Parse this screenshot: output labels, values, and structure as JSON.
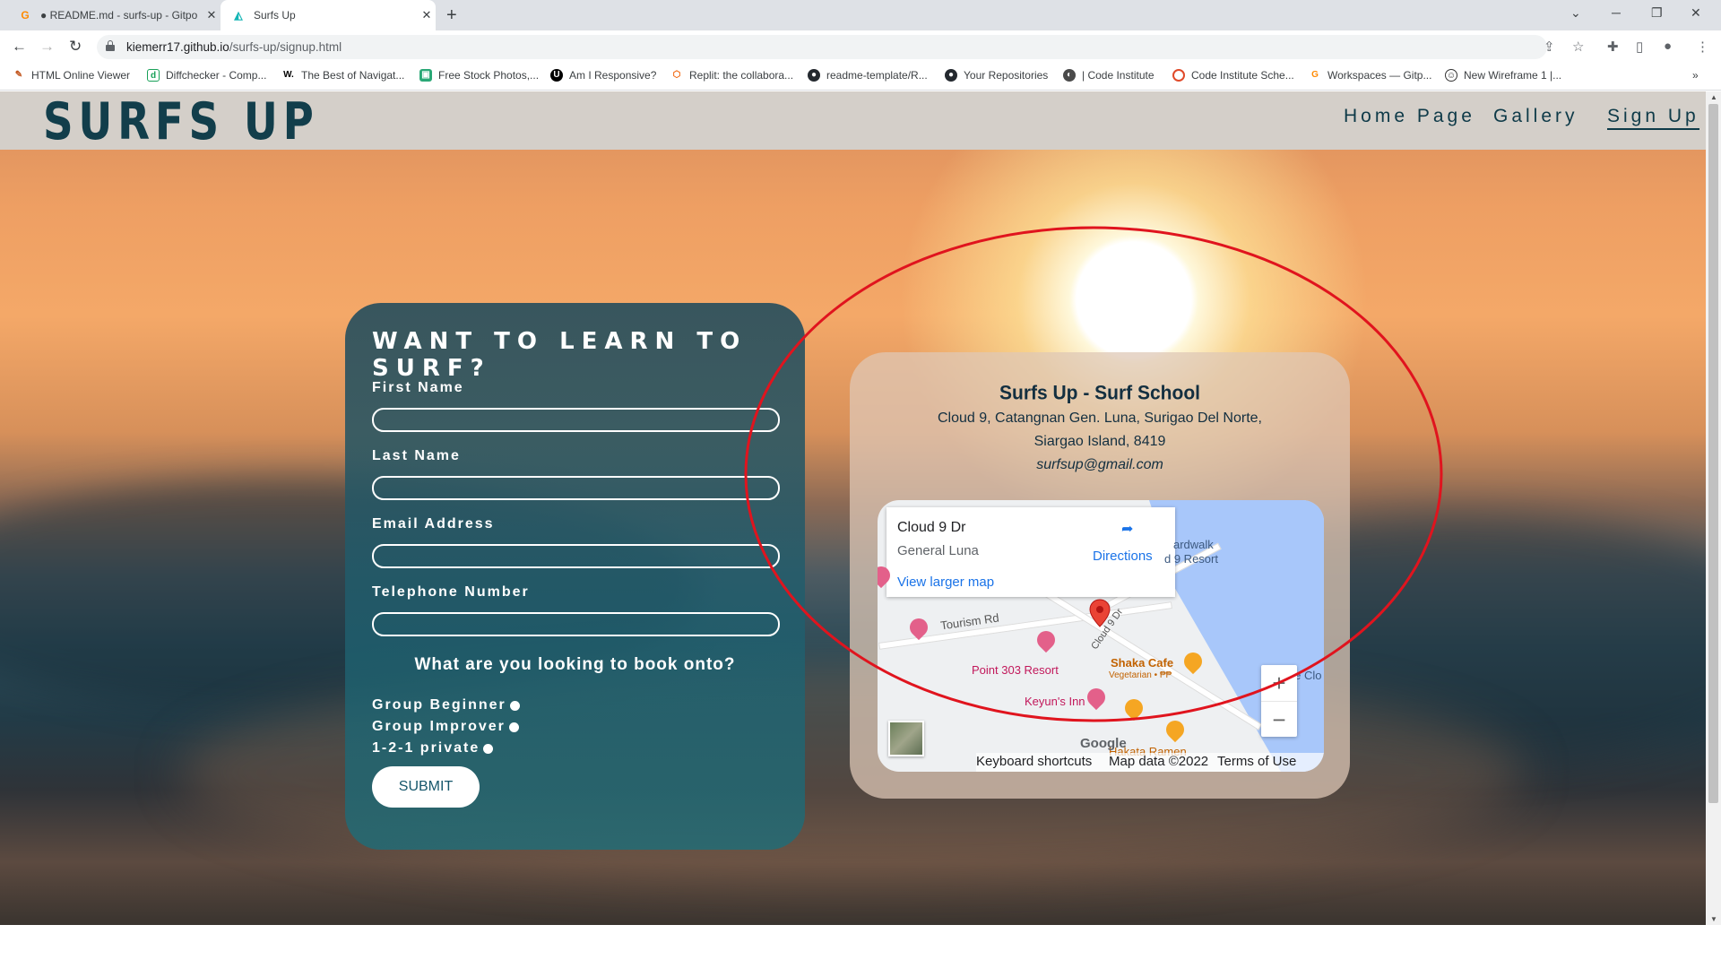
{
  "browser": {
    "tabs": [
      {
        "title": "● README.md - surfs-up - Gitpo",
        "icon": "gitpod-icon",
        "active": false
      },
      {
        "title": "Surfs Up",
        "icon": "surf-logo-icon",
        "active": true
      }
    ],
    "url_host": "kiemerr17.github.io",
    "url_path": "/surfs-up/signup.html",
    "bookmarks": [
      {
        "label": "HTML Online Viewer",
        "icon": "pencil-icon"
      },
      {
        "label": "Diffchecker - Comp...",
        "icon": "diffchecker-icon"
      },
      {
        "label": "The Best of Navigat...",
        "icon": "w-icon"
      },
      {
        "label": "Free Stock Photos,...",
        "icon": "photo-icon"
      },
      {
        "label": "Am I Responsive?",
        "icon": "ui-icon"
      },
      {
        "label": "Replit: the collabora...",
        "icon": "replit-icon"
      },
      {
        "label": "readme-template/R...",
        "icon": "github-icon"
      },
      {
        "label": "Your Repositories",
        "icon": "github-icon"
      },
      {
        "label": "| Code Institute",
        "icon": "ci-icon"
      },
      {
        "label": "Code Institute Sche...",
        "icon": "ci-schedule-icon"
      },
      {
        "label": "Workspaces — Gitp...",
        "icon": "gitpod-icon"
      },
      {
        "label": "New Wireframe 1 |...",
        "icon": "wireframe-icon"
      }
    ]
  },
  "site": {
    "logo": "SURFS UP",
    "nav": [
      {
        "label": "Home Page",
        "active": false
      },
      {
        "label": "Gallery",
        "active": false
      },
      {
        "label": "Sign Up",
        "active": true
      }
    ]
  },
  "form": {
    "title": "WANT TO LEARN TO SURF?",
    "fields": [
      {
        "label": "First Name",
        "value": ""
      },
      {
        "label": "Last Name",
        "value": ""
      },
      {
        "label": "Email Address",
        "value": ""
      },
      {
        "label": "Telephone Number",
        "value": ""
      }
    ],
    "question": "What are you looking to book onto?",
    "options": [
      "Group Beginner",
      "Group Improver",
      "1-2-1 private"
    ],
    "submit": "SUBMIT"
  },
  "info": {
    "name": "Surfs Up - Surf School",
    "address_line1": "Cloud 9, Catangnan Gen. Luna, Surigao Del Norte,",
    "address_line2": "Siargao Island, 8419",
    "email": "surfsup@gmail.com"
  },
  "map": {
    "place_title": "Cloud 9 Dr",
    "place_subtitle": "General Luna",
    "directions": "Directions",
    "larger_map": "View larger map",
    "labels": {
      "tourism_rd": "Tourism Rd",
      "cloud9": "Cloud 9 Dr",
      "point303": "Point 303 Resort",
      "shaka": "Shaka Cafe",
      "shaka_sub": "Vegetarian • ₱₱",
      "keyuns": "Keyun's Inn",
      "hakata": "Hakata Ramen",
      "boardwalk": "ardwalk",
      "resort": "d 9 Resort",
      "theclo": "The Clo"
    },
    "zoom_in": "+",
    "zoom_out": "−",
    "google": "Google",
    "footer": [
      "Keyboard shortcuts",
      "Map data ©2022",
      "Terms of Use"
    ]
  },
  "colors": {
    "header_bg": "#d4cfc9",
    "brand": "#123e4b",
    "annotation_circle": "#e0141e"
  }
}
